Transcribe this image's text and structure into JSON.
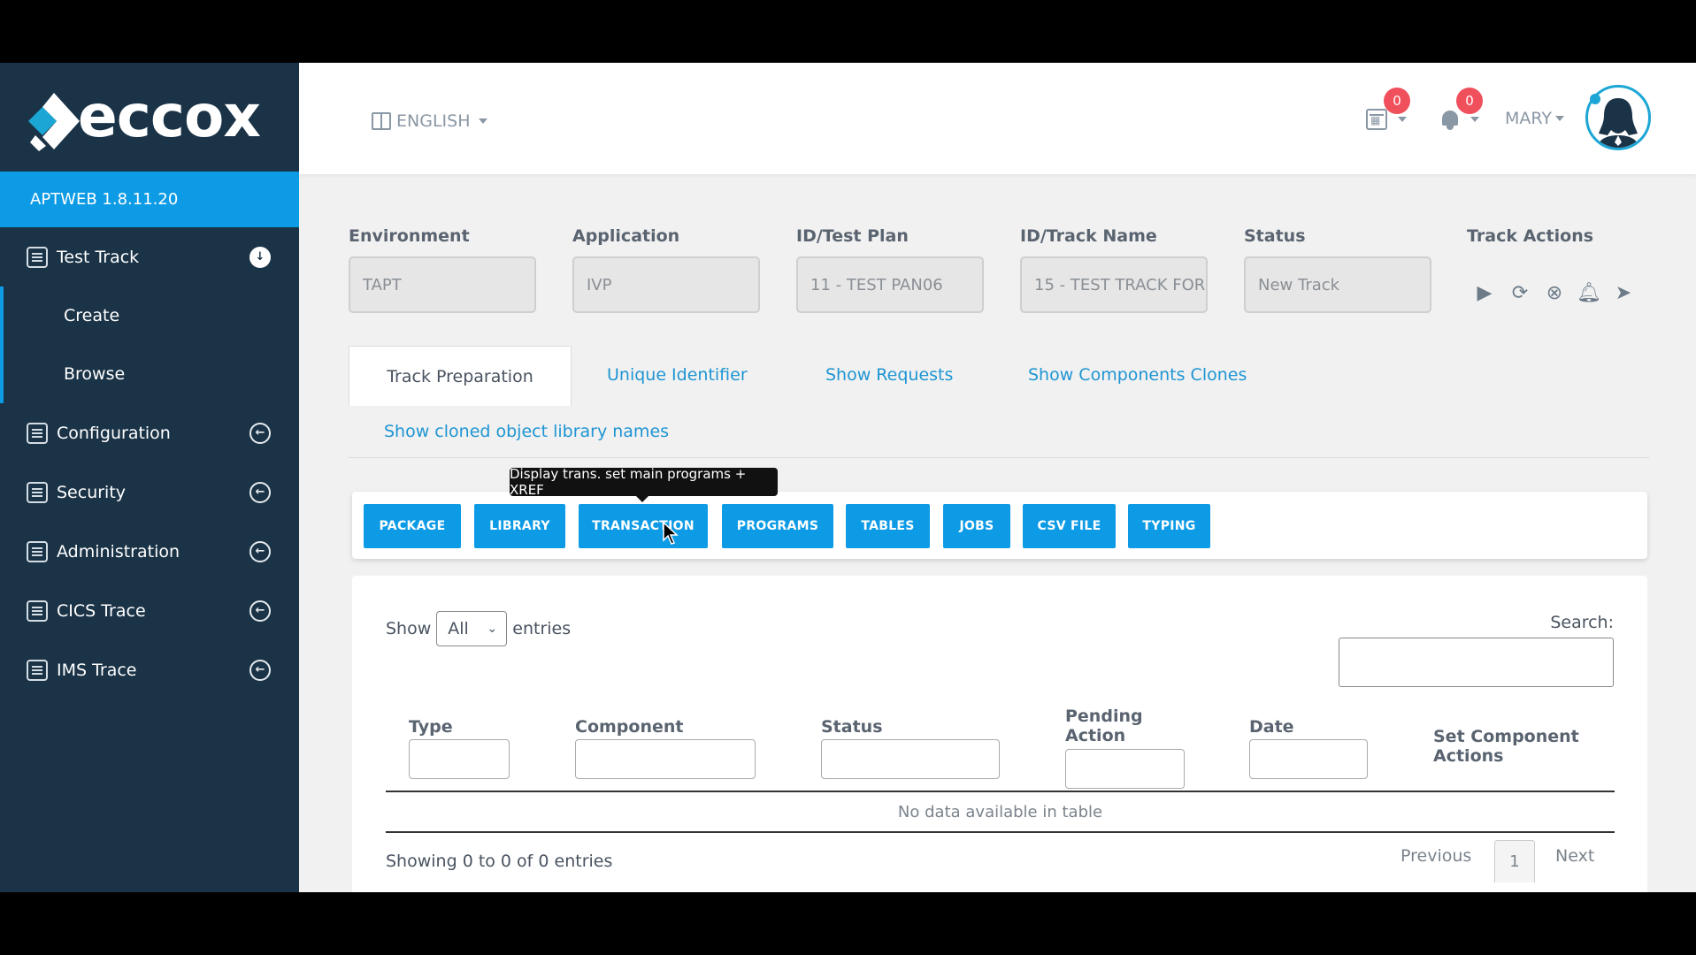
{
  "brand": {
    "logo_text": "eccox",
    "version": "APTWEB 1.8.11.20"
  },
  "sidebar": {
    "items": [
      {
        "label": "Test Track",
        "expanded": true,
        "subitems": [
          "Create",
          "Browse"
        ]
      },
      {
        "label": "Configuration"
      },
      {
        "label": "Security"
      },
      {
        "label": "Administration"
      },
      {
        "label": "CICS Trace"
      },
      {
        "label": "IMS Trace"
      }
    ]
  },
  "header": {
    "language": "ENGLISH",
    "calendar_count": "0",
    "notification_count": "0",
    "user_name": "MARY"
  },
  "fields": [
    {
      "label": "Environment",
      "value": "TAPT"
    },
    {
      "label": "Application",
      "value": "IVP"
    },
    {
      "label": "ID/Test Plan",
      "value": "11 - TEST PAN06"
    },
    {
      "label": "ID/Track Name",
      "value": "15 - TEST TRACK FOR"
    },
    {
      "label": "Status",
      "value": "New Track"
    }
  ],
  "track_actions": {
    "label": "Track Actions",
    "icons": [
      "play-icon",
      "refresh-icon",
      "cancel-icon",
      "bell-icon",
      "send-icon"
    ]
  },
  "tabs": [
    "Track Preparation",
    "Unique Identifier",
    "Show Requests",
    "Show Components Clones",
    "Show cloned object library names"
  ],
  "buttons": [
    "PACKAGE",
    "LIBRARY",
    "TRANSACTION",
    "PROGRAMS",
    "TABLES",
    "JOBS",
    "CSV FILE",
    "TYPING"
  ],
  "tooltip": "Display trans. set main programs + XREF",
  "table": {
    "show_label": "Show",
    "show_value": "All",
    "entries_label": "entries",
    "search_label": "Search:",
    "columns": [
      "Type",
      "Component",
      "Status",
      "Pending Action",
      "Date",
      "Set Component Actions"
    ],
    "empty_text": "No data available in table",
    "info": "Showing 0 to 0 of 0 entries",
    "pager": {
      "previous": "Previous",
      "page": "1",
      "next": "Next"
    }
  },
  "colors": {
    "sidebar": "#1b3347",
    "accent": "#0e9be6",
    "badge": "#f04f5c"
  }
}
